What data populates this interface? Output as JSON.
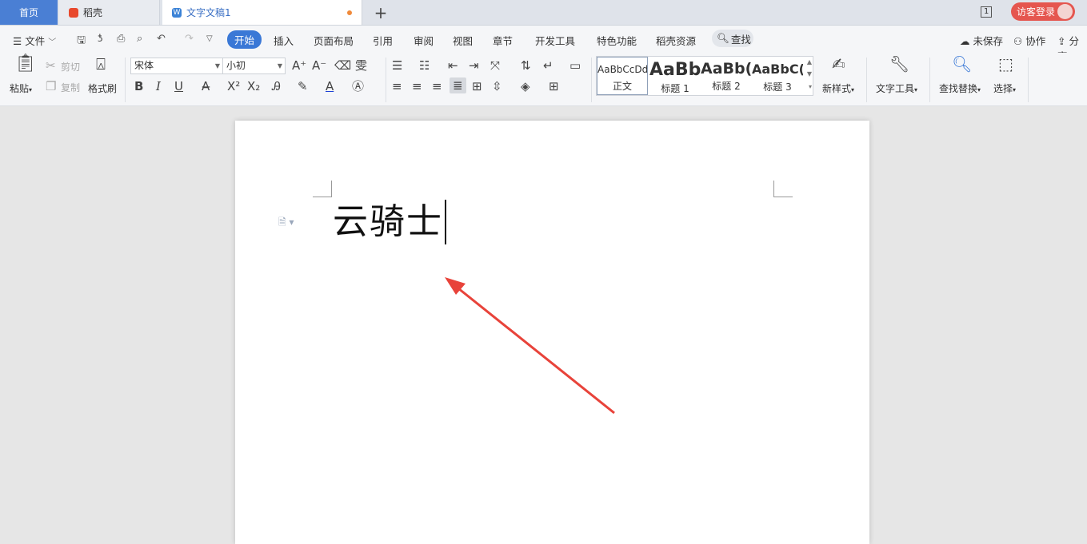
{
  "tabs": {
    "home": "首页",
    "daoke": "稻壳",
    "doc": "文字文稿1",
    "doc_badge": "W",
    "new_tab": "+"
  },
  "topbar": {
    "page_indicator": "1",
    "login_label": "访客登录"
  },
  "menu": {
    "file": "文件",
    "items": [
      "开始",
      "插入",
      "页面布局",
      "引用",
      "审阅",
      "视图",
      "章节",
      "开发工具",
      "特色功能",
      "稻壳资源"
    ],
    "search": "查找",
    "unsaved": "未保存",
    "collab": "协作",
    "share": "分享"
  },
  "ribbon": {
    "paste": "粘贴",
    "cut": "剪切",
    "copy": "复制",
    "format_painter": "格式刷",
    "font_name": "宋体",
    "font_size": "小初",
    "styles": [
      {
        "sample": "AaBbCcDd",
        "label": "正文"
      },
      {
        "sample": "AaBb",
        "label": "标题 1"
      },
      {
        "sample": "AaBb(",
        "label": "标题 2"
      },
      {
        "sample": "AaBbC(",
        "label": "标题 3"
      }
    ],
    "new_style": "新样式",
    "text_tools": "文字工具",
    "find_replace": "查找替换",
    "select": "选择"
  },
  "document": {
    "text": "云骑士"
  },
  "colors": {
    "accent": "#3a78d6",
    "home_tab": "#4a7fd4",
    "login": "#e5564f",
    "arrow": "#e8433a"
  }
}
